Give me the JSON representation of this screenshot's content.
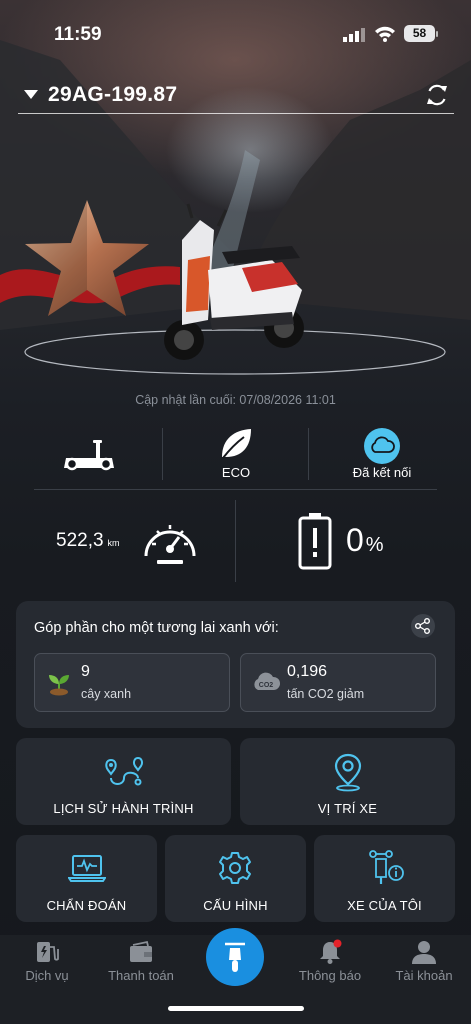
{
  "status_bar": {
    "time": "11:59",
    "battery": "58"
  },
  "vehicle": {
    "plate": "29AG-199.87"
  },
  "last_update": "Cập nhật lần cuối: 07/08/2026 11:01",
  "stats": {
    "mode": "ECO",
    "connection": "Đã kết nối",
    "range_value": "522,3",
    "range_unit": "km",
    "battery_value": "0",
    "battery_unit": "%"
  },
  "green": {
    "title": "Góp phần cho một tương lai xanh với:",
    "trees_value": "9",
    "trees_label": "cây xanh",
    "co2_value": "0,196",
    "co2_label": "tấn CO2 giảm",
    "co2_badge": "CO2"
  },
  "menu": {
    "trip_history": "LỊCH SỬ HÀNH TRÌNH",
    "vehicle_location": "VỊ TRÍ XE",
    "diagnostics": "CHẨN ĐOÁN",
    "configuration": "CẤU HÌNH",
    "my_vehicle": "XE CỦA TÔI"
  },
  "nav": {
    "services": "Dịch vụ",
    "payment": "Thanh toán",
    "notifications": "Thông báo",
    "account": "Tài khoản"
  },
  "colors": {
    "accent": "#1a8fe0",
    "cyan": "#4fc3ee",
    "panel": "#262a31"
  }
}
